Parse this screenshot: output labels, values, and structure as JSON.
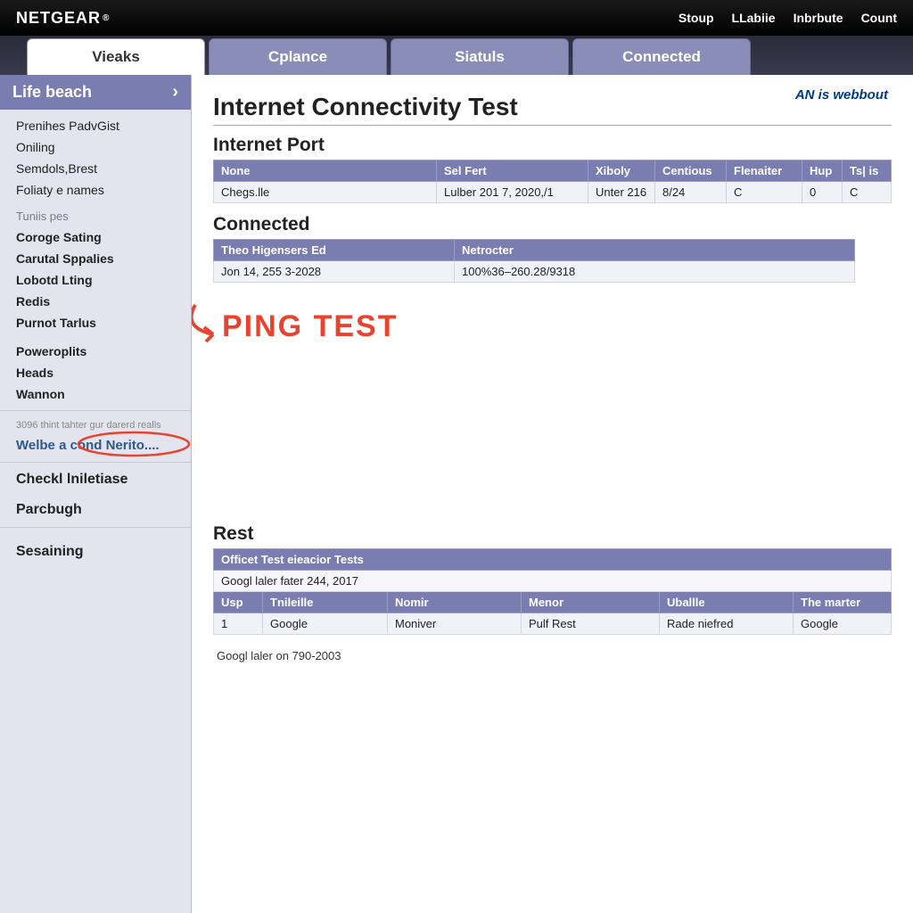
{
  "brand": "NETGEAR",
  "top_nav": [
    "Stoup",
    "LLabiie",
    "Inbrbute",
    "Count"
  ],
  "tabs": [
    "Vieaks",
    "Cplance",
    "Siatuls",
    "Connected"
  ],
  "sidebar": {
    "header": "Life beach",
    "group1": [
      "Prenihes PadvGist",
      "Oniling",
      "Semdols,Brest",
      "Foliaty e names"
    ],
    "subhead": "Tuniis pes",
    "group2": [
      "Coroge Sating",
      "Carutal Sppalies",
      "Lobotd Lting",
      "Redis",
      "Purnot Tarlus"
    ],
    "group3": [
      "Poweroplits",
      "Heads",
      "Wannon"
    ],
    "faded": "3096 thint tahter gur darerd realls",
    "circled": "Welbe a cond Nerito....",
    "group4_a": "Checkl lniletiase",
    "group4_b": "Parcbugh",
    "group5": "Sesaining"
  },
  "an_link": "AN is webbout",
  "page_title": "Internet Connectivity Test",
  "section_port": {
    "title": "Internet Port",
    "headers": [
      "None",
      "Sel Fert",
      "Xiboly",
      "Centious",
      "Flenaiter",
      "Hup",
      "Ts| is"
    ],
    "row": [
      "Chegs.lle",
      "Lulber 201 7, 2020,/1",
      "Unter 216",
      "8/24",
      "C",
      "0",
      "C"
    ]
  },
  "section_connected": {
    "title": "Connected",
    "headers": [
      "Theo Higensers Ed",
      "Netrocter"
    ],
    "row": [
      "Jon 14, 255 3-2028",
      "100%36–260.28/9318"
    ]
  },
  "ping_label": "PING TEST",
  "section_rest": {
    "title": "Rest",
    "banner": "Officet Test eieacior Tests",
    "caption": "Googl laler fater 244, 2017",
    "headers": [
      "Usp",
      "Tnileille",
      "Nomir",
      "Menor",
      "Uballle",
      "The marter"
    ],
    "row": [
      "1",
      "Google",
      "Moniver",
      "Pulf Rest",
      "Rade niefred",
      "Google"
    ],
    "footer": "Googl laler on 790-2003"
  }
}
